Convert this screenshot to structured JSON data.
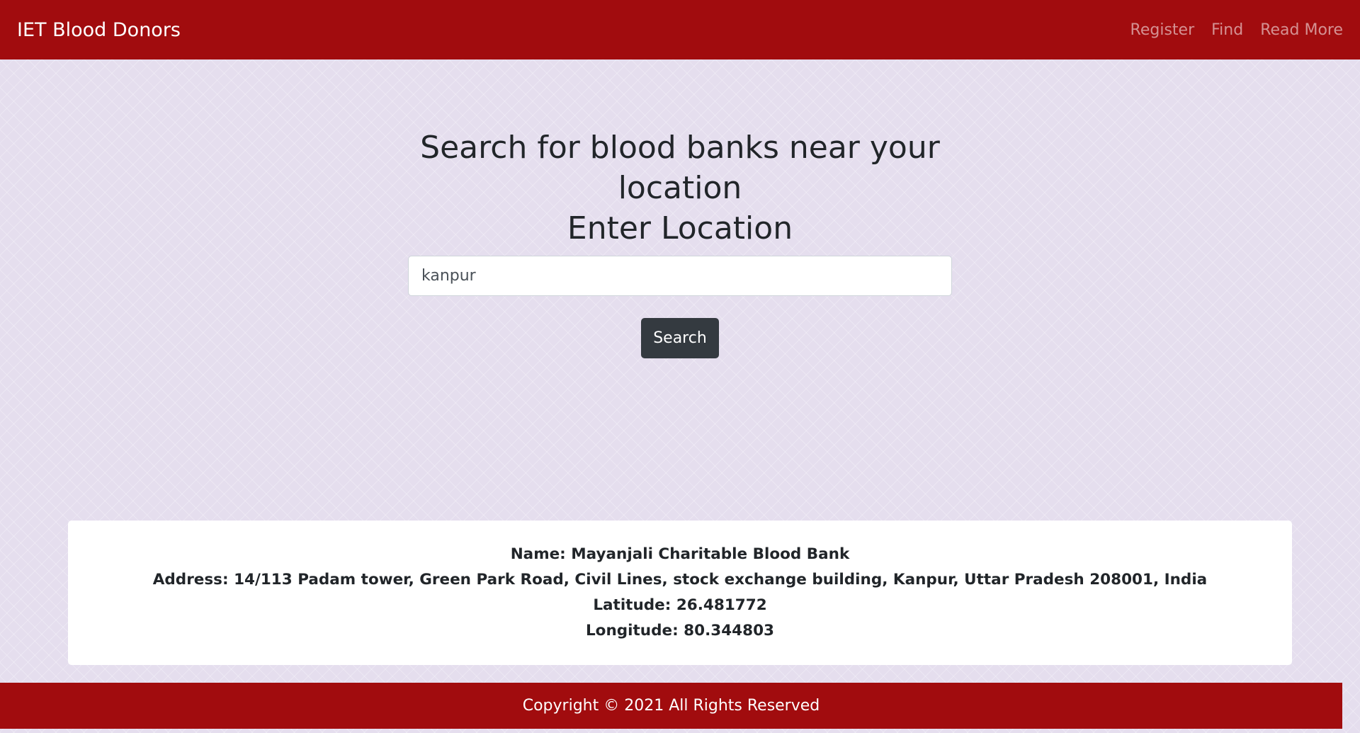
{
  "navbar": {
    "brand": "IET Blood Donors",
    "links": [
      "Register",
      "Find",
      "Read More"
    ]
  },
  "search": {
    "heading_line1": "Search for blood banks near your location",
    "heading_line2": "Enter Location",
    "input_value": "kanpur",
    "button_label": "Search"
  },
  "result": {
    "name": "Name: Mayanjali Charitable Blood Bank",
    "address": "Address: 14/113 Padam tower, Green Park Road, Civil Lines, stock exchange building, Kanpur, Uttar Pradesh 208001, India",
    "latitude": "Latitude: 26.481772",
    "longitude": "Longitude: 80.344803"
  },
  "footer": {
    "text": "Copyright © 2021 All Rights Reserved"
  },
  "colors": {
    "brand_red": "#a10c0e",
    "button_dark": "#343a40",
    "page_background": "#e5deee"
  }
}
